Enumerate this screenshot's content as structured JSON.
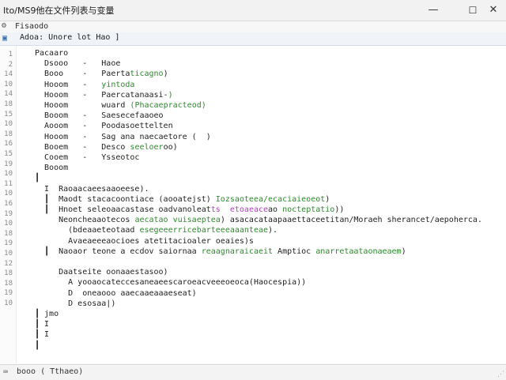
{
  "window": {
    "title": "Ito/MS9他在文件列表与变量",
    "minimize_glyph": "—",
    "maximize_glyph": "☐",
    "close_glyph": "✕"
  },
  "toolbar": {
    "icon": "gear-icon",
    "label": "Fisaodo"
  },
  "tab": {
    "icon": "file-icon",
    "label": "Adoa: Unore lot Hao ]"
  },
  "gutter": {
    "numbers": [
      "1",
      "2",
      "14",
      "10",
      "14",
      "18",
      "15",
      "10",
      "18",
      "16",
      "15",
      "19",
      "10",
      "11",
      "10",
      "16",
      "19",
      "10",
      "18",
      "19",
      "10",
      "12",
      "18",
      "18",
      "19",
      "10"
    ],
    "lines": [
      {
        "t": 1,
        "text": ""
      },
      {
        "t": "x",
        "text": ""
      }
    ]
  },
  "code_lines": [
    {
      "segments": [
        {
          "text": "Pacaaro",
          "c": ""
        }
      ]
    },
    {
      "segments": [
        {
          "text": "  Dsooo   -   Haoe",
          "c": ""
        }
      ]
    },
    {
      "segments": [
        {
          "text": "  Booo    -   Paerta",
          "c": ""
        },
        {
          "text": "ticagno",
          "c": "g"
        },
        {
          "text": ")",
          "c": ""
        }
      ]
    },
    {
      "segments": [
        {
          "text": "  Hooom   -   ",
          "c": ""
        },
        {
          "text": "yintoda",
          "c": "g"
        }
      ]
    },
    {
      "segments": [
        {
          "text": "  Hooom   -   Paercatanaasi-",
          "c": ""
        },
        {
          "text": ")",
          "c": "g"
        }
      ]
    },
    {
      "segments": [
        {
          "text": "  Hooom       wuard ",
          "c": ""
        },
        {
          "text": "(Phacaepracteod)",
          "c": "g"
        }
      ]
    },
    {
      "segments": [
        {
          "text": "  Booom   -   Saesecefaaoeo",
          "c": ""
        }
      ]
    },
    {
      "segments": [
        {
          "text": "  Aooom   -   Poodasoettelten",
          "c": ""
        }
      ]
    },
    {
      "segments": [
        {
          "text": "  Hooom   -   Sag ana naecaetore (  )",
          "c": ""
        }
      ]
    },
    {
      "segments": [
        {
          "text": "  Booem   -   Desco ",
          "c": ""
        },
        {
          "text": "seeloer",
          "c": "g"
        },
        {
          "text": "oo)",
          "c": ""
        }
      ]
    },
    {
      "segments": [
        {
          "text": "  Cooem   -   Ysseotoc",
          "c": ""
        }
      ]
    },
    {
      "segments": [
        {
          "text": "  Booom",
          "c": ""
        }
      ]
    },
    {
      "segments": [
        {
          "text": "┃",
          "c": ""
        }
      ]
    },
    {
      "segments": [
        {
          "text": "  I  Raoaacaeesaaoeese).",
          "c": ""
        }
      ]
    },
    {
      "segments": [
        {
          "text": "  ┃  Maodt stacacoontiace (aooatejst) ",
          "c": ""
        },
        {
          "text": "Iozsaoteea/ecaciaieoeot",
          "c": "g"
        },
        {
          "text": ")",
          "c": ""
        }
      ]
    },
    {
      "segments": [
        {
          "text": "  ┃  Hnoet seleoaacastase oadvanoleat",
          "c": ""
        },
        {
          "text": "ts",
          "c": "p"
        },
        {
          "text": "  ",
          "c": ""
        },
        {
          "text": "etoaeace",
          "c": "p"
        },
        {
          "text": "ao ",
          "c": ""
        },
        {
          "text": "nocteptatio",
          "c": "g"
        },
        {
          "text": "))",
          "c": ""
        }
      ]
    },
    {
      "segments": [
        {
          "text": "     Neoncheaaotecos ",
          "c": ""
        },
        {
          "text": "aecatao vuisaeptea",
          "c": "g"
        },
        {
          "text": ") asacacataapaaettaceetitan/Moraeh sherancet/aepoherca.",
          "c": ""
        }
      ]
    },
    {
      "segments": [
        {
          "text": "       (bdeaaeteotaad ",
          "c": ""
        },
        {
          "text": "esegeeerricebarteeeaaanteae",
          "c": "g"
        },
        {
          "text": ").",
          "c": ""
        }
      ]
    },
    {
      "segments": [
        {
          "text": "       Avaeaeeeaocioes atetitacioaler oeaies)s",
          "c": ""
        }
      ]
    },
    {
      "segments": [
        {
          "text": "  ┃  Naoaor teone a ecdov saiornaa ",
          "c": ""
        },
        {
          "text": "reaagnaraicaeit",
          "c": "g"
        },
        {
          "text": " Amptioc ",
          "c": ""
        },
        {
          "text": "anarretaataonaeaem",
          "c": "g"
        },
        {
          "text": ")",
          "c": ""
        }
      ]
    },
    {
      "segments": [
        {
          "text": "",
          "c": ""
        }
      ]
    },
    {
      "segments": [
        {
          "text": "     Daatseite oonaaestasoo)",
          "c": ""
        }
      ]
    },
    {
      "segments": [
        {
          "text": "       A yooaocateccesaneaeescaroeacveeeoeoca(Haocespia))",
          "c": ""
        }
      ]
    },
    {
      "segments": [
        {
          "text": "       D  oneaooo aaecaaeaaaeseat)",
          "c": ""
        }
      ]
    },
    {
      "segments": [
        {
          "text": "       D esosaa|)",
          "c": ""
        }
      ]
    },
    {
      "segments": [
        {
          "text": "┃ jmo",
          "c": ""
        }
      ]
    },
    {
      "segments": [
        {
          "text": "┃ I",
          "c": ""
        }
      ]
    },
    {
      "segments": [
        {
          "text": "┃ I",
          "c": ""
        }
      ]
    },
    {
      "segments": [
        {
          "text": "┃",
          "c": ""
        }
      ]
    }
  ],
  "status": {
    "icon": "terminal-icon",
    "text": "booo ( Tthaeo)",
    "grip": "⋰"
  }
}
